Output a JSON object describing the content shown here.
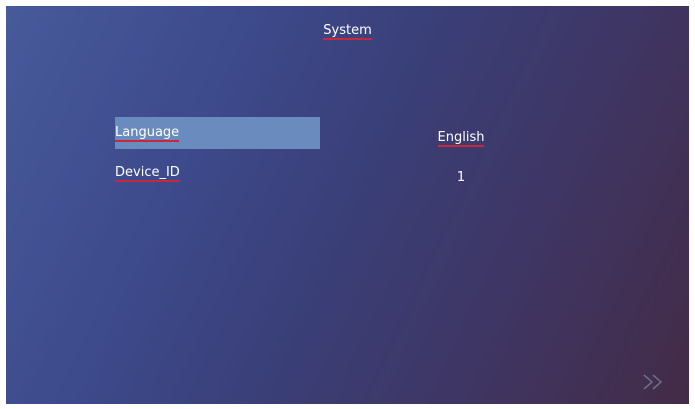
{
  "header": {
    "title": "System"
  },
  "settings": [
    {
      "label": "Language",
      "value": "English",
      "selected": true
    },
    {
      "label": "Device_ID",
      "value": "1",
      "selected": false
    }
  ],
  "icons": {
    "next": "double-chevron-right-icon"
  },
  "colors": {
    "selection": "#6a8bbd",
    "underline": "#c8283c",
    "text": "#ffffff"
  }
}
